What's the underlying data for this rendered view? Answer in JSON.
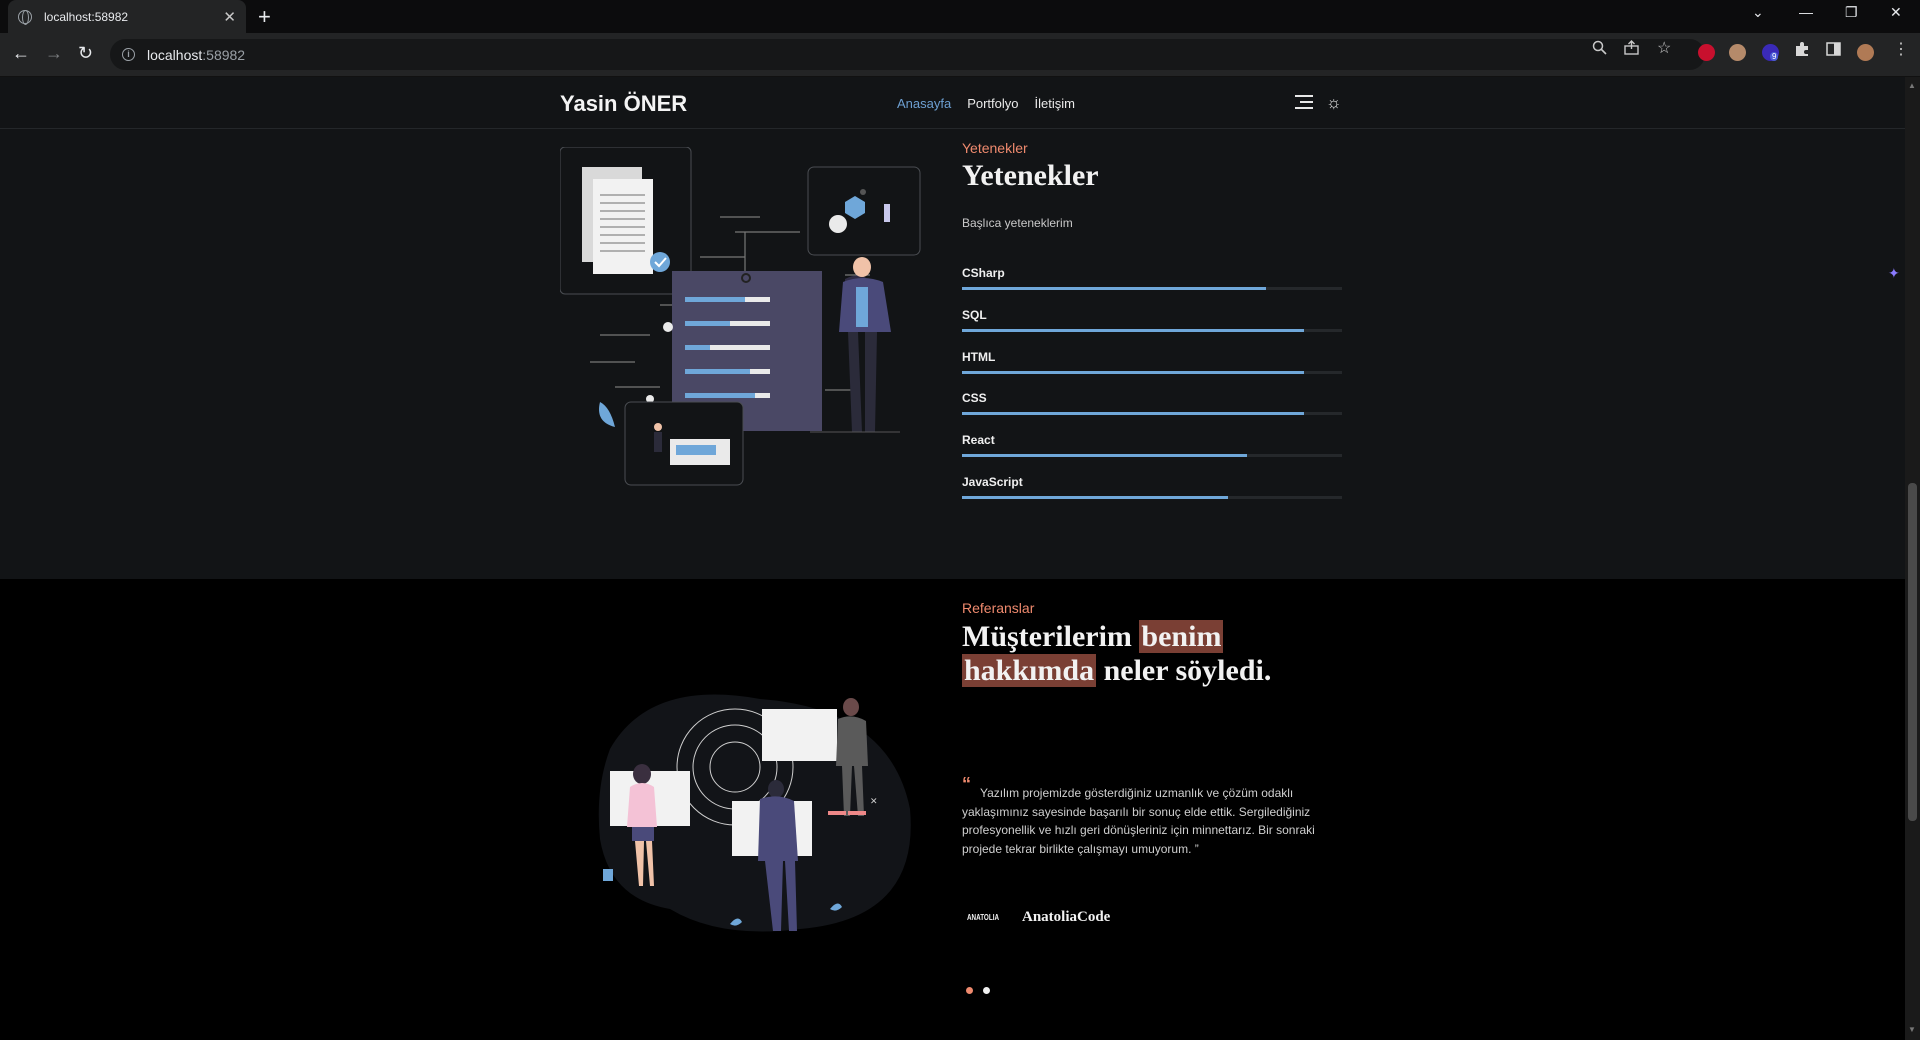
{
  "browser": {
    "tab_title": "localhost:58982",
    "url_host": "localhost",
    "url_port": ":58982",
    "extension_badge": "9"
  },
  "site": {
    "brand": "Yasin ÖNER",
    "nav": [
      "Anasayfa",
      "Portfolyo",
      "İletişim"
    ],
    "active_nav": "Anasayfa"
  },
  "skills": {
    "eyebrow": "Yetenekler",
    "title": "Yetenekler",
    "subtitle": "Başlıca yeteneklerim",
    "items": [
      {
        "name": "CSharp",
        "level": 0.8
      },
      {
        "name": "SQL",
        "level": 0.9
      },
      {
        "name": "HTML",
        "level": 0.9
      },
      {
        "name": "CSS",
        "level": 0.9
      },
      {
        "name": "React",
        "level": 0.75
      },
      {
        "name": "JavaScript",
        "level": 0.7
      }
    ]
  },
  "references": {
    "eyebrow": "Referanslar",
    "title_part1": "Müşterilerim ",
    "title_hl1": "benim",
    "title_hl2": "hakkımda",
    "title_part2": " neler söyledi.",
    "quote_mark": "“",
    "quote": "Yazılım projemizde gösterdiğiniz uzmanlık ve çözüm odaklı yaklaşımınız sayesinde başarılı bir sonuç elde ettik. Sergilediğiniz profesyonellik ve hızlı geri dönüşleriniz için minnettarız. Bir sonraki projede tekrar birlikte çalışmayı umuyorum. ”",
    "company": "AnatoliaCode",
    "company_logo_text": "ANATOLIA",
    "active_slide": 1,
    "slide_count": 2
  },
  "colors": {
    "accent": "#ef8a6e",
    "link_active": "#6d9fd1",
    "bar_fill": "#6fa7d9",
    "highlight": "#7a3f34"
  },
  "icons": [
    "globe-icon",
    "close-icon",
    "plus-icon",
    "back-icon",
    "forward-icon",
    "reload-icon",
    "info-icon",
    "zoom-icon",
    "share-icon",
    "star-icon",
    "puzzle-icon",
    "sidepanel-icon",
    "profile-icon",
    "menu-icon",
    "sun-icon",
    "sparkle-icon"
  ]
}
